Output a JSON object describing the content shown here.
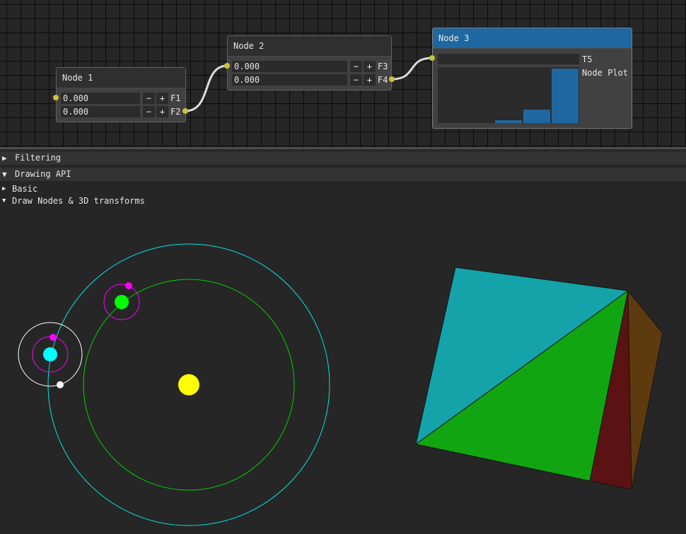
{
  "node_editor": {
    "nodes": [
      {
        "title": "Node 1",
        "slots": [
          {
            "value": "0.000",
            "minus": "−",
            "plus": "+",
            "label": "F1"
          },
          {
            "value": "0.000",
            "minus": "−",
            "plus": "+",
            "label": "F2"
          }
        ]
      },
      {
        "title": "Node 2",
        "slots": [
          {
            "value": "0.000",
            "minus": "−",
            "plus": "+",
            "label": "F3"
          },
          {
            "value": "0.000",
            "minus": "−",
            "plus": "+",
            "label": "F4"
          }
        ]
      },
      {
        "title": "Node 3",
        "text_label": "T5",
        "plot_label": "Node Plot",
        "plot_values": [
          0,
          0,
          0.05,
          0.25,
          1.0
        ]
      }
    ],
    "colors": {
      "pin": "#c8c339",
      "link": "#dcdcdc",
      "selected_header": "#1f67a0",
      "plot_bar": "#1f67a0"
    }
  },
  "sections": {
    "filtering": {
      "arrow": "▶",
      "title": "Filtering"
    },
    "drawing_api": {
      "arrow": "▼",
      "title": "Drawing API"
    },
    "basic": {
      "arrow": "▶",
      "title": "Basic"
    },
    "draw_nodes": {
      "arrow": "▼",
      "title": "Draw Nodes & 3D transforms"
    }
  },
  "scene": {
    "colors": {
      "sun": "#ffff00",
      "orbit_outer": "#00e6e6",
      "orbit_inner": "#00d200",
      "planet_cyan": "#00ffff",
      "planet_green": "#00ff00",
      "moon": "#ff00ff",
      "satellite": "#ffffff",
      "pyramid_cyan": "#13a3a9",
      "pyramid_green": "#12a512",
      "pyramid_red": "#5a1212",
      "pyramid_brown": "#5e3a0f"
    }
  }
}
